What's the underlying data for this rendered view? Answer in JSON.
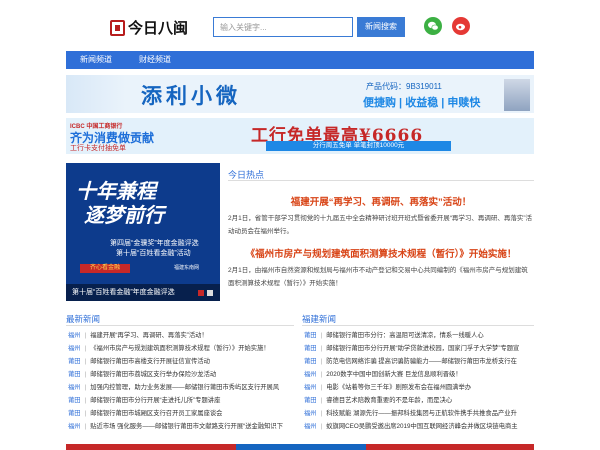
{
  "header": {
    "logo_text": "今日八闽",
    "search_placeholder": "输入关键字...",
    "search_button": "新闻搜索"
  },
  "nav": {
    "items": [
      "新闻频道",
      "财经频道"
    ]
  },
  "banner1": {
    "title": "添利小微",
    "product_code": "产品代码：9B319011",
    "slogan": "便捷购 | 收益稳 | 申赎快"
  },
  "banner2": {
    "bank": "ICBC 中国工商银行",
    "left_main": "齐为消费做贡献",
    "left_sub": "工行卡支付抽免单",
    "headline": "工行免单最高¥6666",
    "sub": "分行周五免单 单笔封顶10000元"
  },
  "feature": {
    "line1": "十年兼程",
    "line2": "逐梦前行",
    "sub1": "第四届“金骥奖”年度金融评选",
    "sub2": "第十届“百姓看金融”活动",
    "tag": "齐心看金融",
    "tag2": "福建东南网",
    "caption": "第十届“百姓看金融”年度金融评选"
  },
  "hot": {
    "title": "今日热点",
    "items": [
      {
        "headline": "福建开展“再学习、再调研、再落实”活动！",
        "summary": "2月1日，省管干部学习贯彻党的十九届五中全会精神研讨班开班式暨省委开展“再学习、再调研、再落实”活动动员会在福州举行。"
      },
      {
        "headline": "《福州市房产与规划建筑面积测算技术规程（暂行）》开始实施！",
        "summary": "2月1日，由福州市自然资源和规划局与福州市不动产登记和交易中心共同编制的《福州市房产与规划建筑面积测算技术规程（暂行）》开始实施！"
      }
    ]
  },
  "latest": {
    "title": "最新新闻",
    "items": [
      {
        "cat": "福州",
        "text": "福建开展“再学习、再调研、再落实”活动！"
      },
      {
        "cat": "福州",
        "text": "《福州市房产与规划建筑面积测算技术规程（暂行）》开始实施！"
      },
      {
        "cat": "莆田",
        "text": "邮储银行莆田市高楼支行开展征信宣传活动"
      },
      {
        "cat": "莆田",
        "text": "邮储银行莆田市荔城区支行举办保险沙龙活动"
      },
      {
        "cat": "福州",
        "text": "加强内控管理，助力业务发展——邮储银行莆田市秀屿区支行开展风"
      },
      {
        "cat": "莆田",
        "text": "邮储银行莆田市分行开展“走进托儿所”专题讲座"
      },
      {
        "cat": "莆田",
        "text": "邮储银行莆田市城厢区支行召开员工家属座谈会"
      },
      {
        "cat": "福州",
        "text": "贴近市场 强化服务——邮储银行莆田市文献路支行开展“送金融知识下"
      }
    ]
  },
  "fujian": {
    "title": "福建新闻",
    "items": [
      {
        "cat": "莆田",
        "text": "邮储银行莆田市分行：高温阻可送清凉，情系一线暖人心"
      },
      {
        "cat": "莆田",
        "text": "邮储银行莆田市分行开展“助学贷款进校园，国家门孚子大学梦”专题宣"
      },
      {
        "cat": "莆田",
        "text": "防范电信网络诈骗 提高识骗防骗能力——邮储银行莆田市龙桥支行在"
      },
      {
        "cat": "福州",
        "text": "2020数字中国中国创新大赛 巨龙信息顺利晋级！"
      },
      {
        "cat": "福州",
        "text": "电影《站着等你三千年》剧照发布会在福州圆满举办"
      },
      {
        "cat": "莆田",
        "text": "睿德目艺术陪教育重要的不是年龄，而是决心"
      },
      {
        "cat": "福州",
        "text": "科技赋能 湖源先行——振邦科技集团与正航软件携手共推食品产业升"
      },
      {
        "cat": "福州",
        "text": "蚁旗网CEO吴鹏受邀出席2019中国互联网经济峰会并做区块链电商主"
      }
    ]
  },
  "colors": {
    "brand_blue": "#2f6fd8",
    "headline_orange": "#d84315",
    "logo_red": "#b71c1c"
  }
}
